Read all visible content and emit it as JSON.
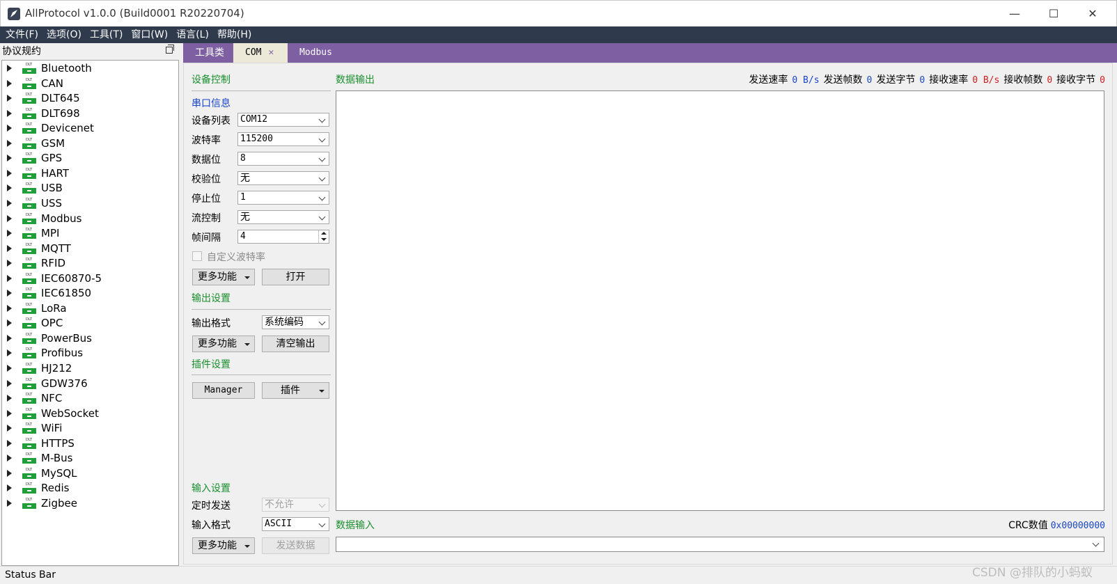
{
  "window": {
    "title": "AllProtocol v1.0.0  (Build0001 R20220704)",
    "minimize": "—",
    "maximize": "☐",
    "close": "✕"
  },
  "menu": [
    "文件(F)",
    "选项(O)",
    "工具(T)",
    "窗口(W)",
    "语言(L)",
    "帮助(H)"
  ],
  "dock": {
    "title": "协议规约",
    "icon_text": "DLT",
    "protocols": [
      "Bluetooth",
      "CAN",
      "DLT645",
      "DLT698",
      "Devicenet",
      "GSM",
      "GPS",
      "HART",
      "USB",
      "USS",
      "Modbus",
      "MPI",
      "MQTT",
      "RFID",
      "IEC60870-5",
      "IEC61850",
      "LoRa",
      "OPC",
      "PowerBus",
      "Profibus",
      "HJ212",
      "GDW376",
      "NFC",
      "WebSocket",
      "WiFi",
      "HTTPS",
      "M-Bus",
      "MySQL",
      "Redis",
      "Zigbee"
    ]
  },
  "tabs": {
    "tools": "工具类",
    "com": "COM",
    "com_close": "✕",
    "modbus": "Modbus"
  },
  "device": {
    "title": "设备控制",
    "serial_title": "串口信息",
    "fields": {
      "device_list": {
        "label": "设备列表",
        "value": "COM12"
      },
      "baud": {
        "label": "波特率",
        "value": "115200"
      },
      "data_bits": {
        "label": "数据位",
        "value": "8"
      },
      "parity": {
        "label": "校验位",
        "value": "无"
      },
      "stop_bits": {
        "label": "停止位",
        "value": "1"
      },
      "flow": {
        "label": "流控制",
        "value": "无"
      },
      "interval": {
        "label": "帧间隔",
        "value": "4"
      }
    },
    "custom_baud": "自定义波特率",
    "more": "更多功能",
    "open": "打开"
  },
  "output_settings": {
    "title": "输出设置",
    "format_label": "输出格式",
    "format_value": "系统编码",
    "more": "更多功能",
    "clear": "清空输出"
  },
  "plugin_settings": {
    "title": "插件设置",
    "manager": "Manager",
    "plugin": "插件"
  },
  "input_settings": {
    "title": "输入设置",
    "timer_label": "定时发送",
    "timer_value": "不允许",
    "format_label": "输入格式",
    "format_value": "ASCII",
    "more": "更多功能",
    "send": "发送数据"
  },
  "data_output": {
    "title": "数据输出",
    "send_rate_label": "发送速率",
    "send_rate": "0 B/s",
    "send_frames_label": "发送帧数",
    "send_frames": "0",
    "send_bytes_label": "发送字节",
    "send_bytes": "0",
    "recv_rate_label": "接收速率",
    "recv_rate": "0 B/s",
    "recv_frames_label": "接收帧数",
    "recv_frames": "0",
    "recv_bytes_label": "接收字节",
    "recv_bytes": "0"
  },
  "data_input": {
    "title": "数据输入",
    "crc_label": "CRC数值",
    "crc_value": "0x00000000"
  },
  "status_bar": "Status Bar",
  "watermark": "CSDN @排队的小蚂蚁",
  "colors": {
    "menubar": "#2f3a4d",
    "tabbar": "#7e5fa1",
    "section_green": "#1a8f2e",
    "section_blue": "#1a45c7",
    "stat_red": "#d41c1c"
  }
}
